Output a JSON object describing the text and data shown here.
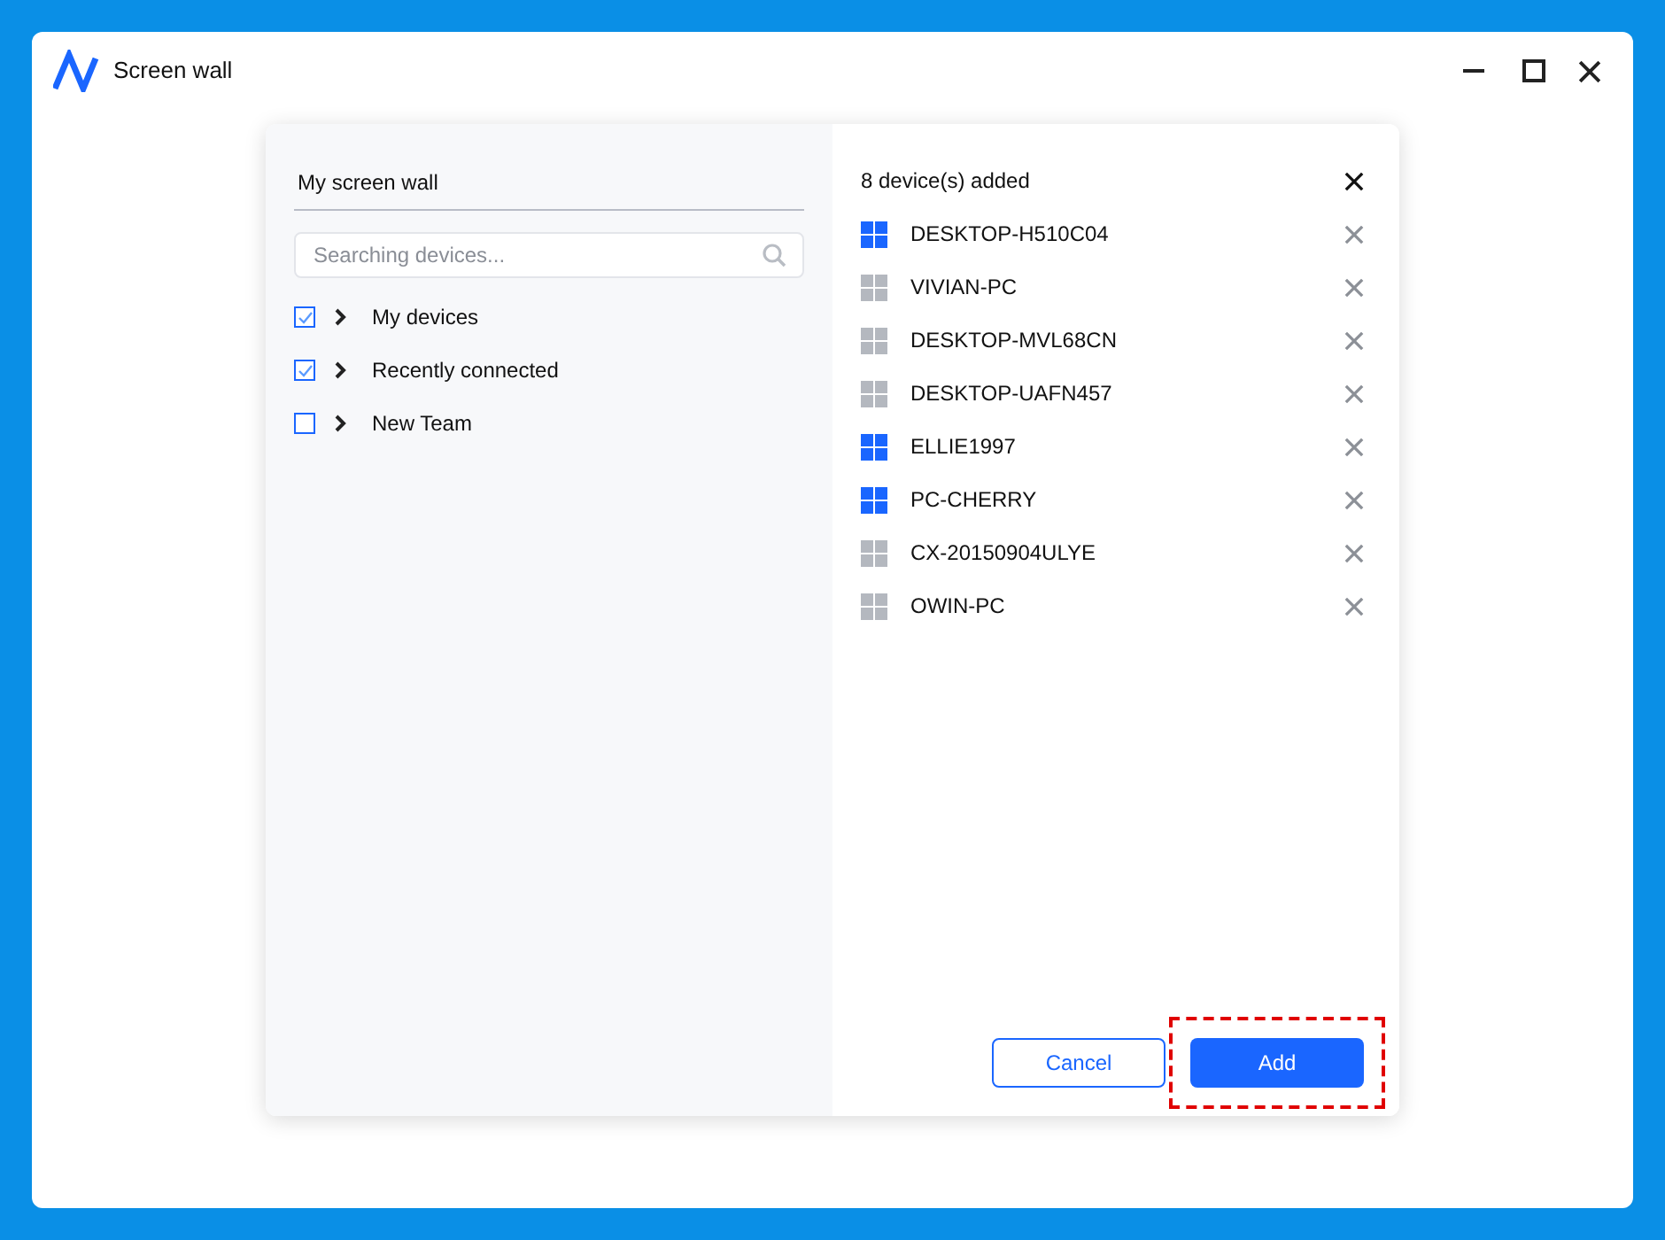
{
  "window": {
    "title": "Screen wall"
  },
  "left_panel": {
    "title": "My screen wall",
    "search": {
      "placeholder": "Searching devices..."
    },
    "groups": [
      {
        "label": "My devices",
        "checked": true,
        "expanded": false
      },
      {
        "label": "Recently connected",
        "checked": true,
        "expanded": false
      },
      {
        "label": "New Team",
        "checked": false,
        "expanded": false
      }
    ]
  },
  "right_panel": {
    "count_label": "8 device(s) added",
    "devices": [
      {
        "name": "DESKTOP-H510C04",
        "online": true
      },
      {
        "name": "VIVIAN-PC",
        "online": false
      },
      {
        "name": "DESKTOP-MVL68CN",
        "online": false
      },
      {
        "name": "DESKTOP-UAFN457",
        "online": false
      },
      {
        "name": "ELLIE1997",
        "online": true
      },
      {
        "name": "PC-CHERRY",
        "online": true
      },
      {
        "name": "CX-20150904ULYE",
        "online": false
      },
      {
        "name": "OWIN-PC",
        "online": false
      }
    ]
  },
  "buttons": [
    {
      "label": "Cancel",
      "kind": "secondary",
      "highlighted": false
    },
    {
      "label": "Add",
      "kind": "primary",
      "highlighted": true
    }
  ]
}
